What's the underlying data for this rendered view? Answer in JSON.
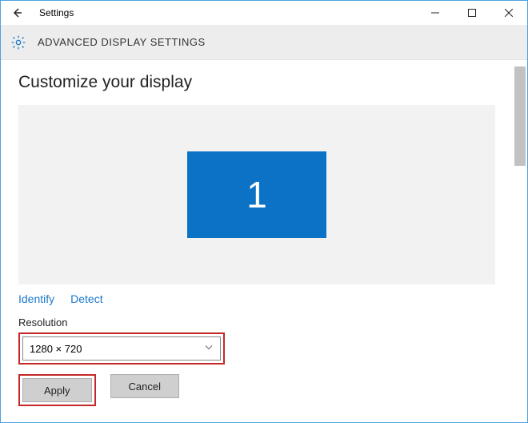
{
  "window": {
    "title": "Settings"
  },
  "ribbon": {
    "title": "ADVANCED DISPLAY SETTINGS"
  },
  "page": {
    "heading": "Customize your display",
    "monitor_id": "1",
    "identify_label": "Identify",
    "detect_label": "Detect",
    "resolution_label": "Resolution",
    "resolution_value": "1280 × 720",
    "apply_label": "Apply",
    "cancel_label": "Cancel"
  }
}
